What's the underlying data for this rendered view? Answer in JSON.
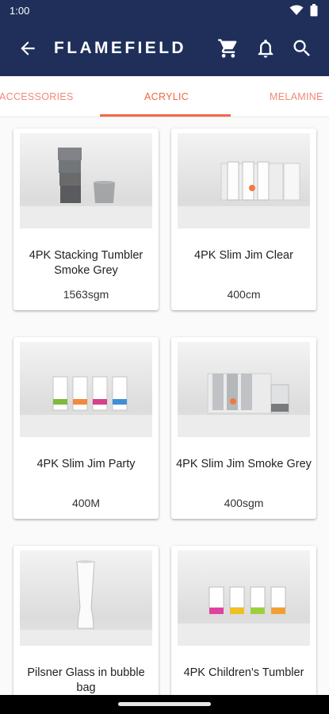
{
  "status_bar": {
    "time": "1:00"
  },
  "app_bar": {
    "title": "FLAMEFIELD"
  },
  "tabs": [
    {
      "label": "ACCESSORIES",
      "active": false
    },
    {
      "label": "ACRYLIC",
      "active": true
    },
    {
      "label": "MELAMINE",
      "active": false
    }
  ],
  "colors": {
    "header": "#1f2f5a",
    "accent": "#f0683f"
  },
  "products": [
    {
      "title": "4PK Stacking Tumbler Smoke Grey",
      "size": "1563sgm",
      "image": "stacked-smoke-tumblers"
    },
    {
      "title": "4PK Slim Jim Clear",
      "size": "400cm",
      "image": "boxed-clear-tumblers"
    },
    {
      "title": "4PK Slim Jim Party",
      "size": "400M",
      "image": "colored-band-tumblers"
    },
    {
      "title": "4PK Slim Jim Smoke Grey",
      "size": "400sgm",
      "image": "boxed-smoke-tumblers"
    },
    {
      "title": "Pilsner Glass in bubble bag",
      "size": "",
      "image": "pilsner-glass"
    },
    {
      "title": "4PK Children's Tumbler",
      "size": "",
      "image": "children-tumblers"
    }
  ]
}
